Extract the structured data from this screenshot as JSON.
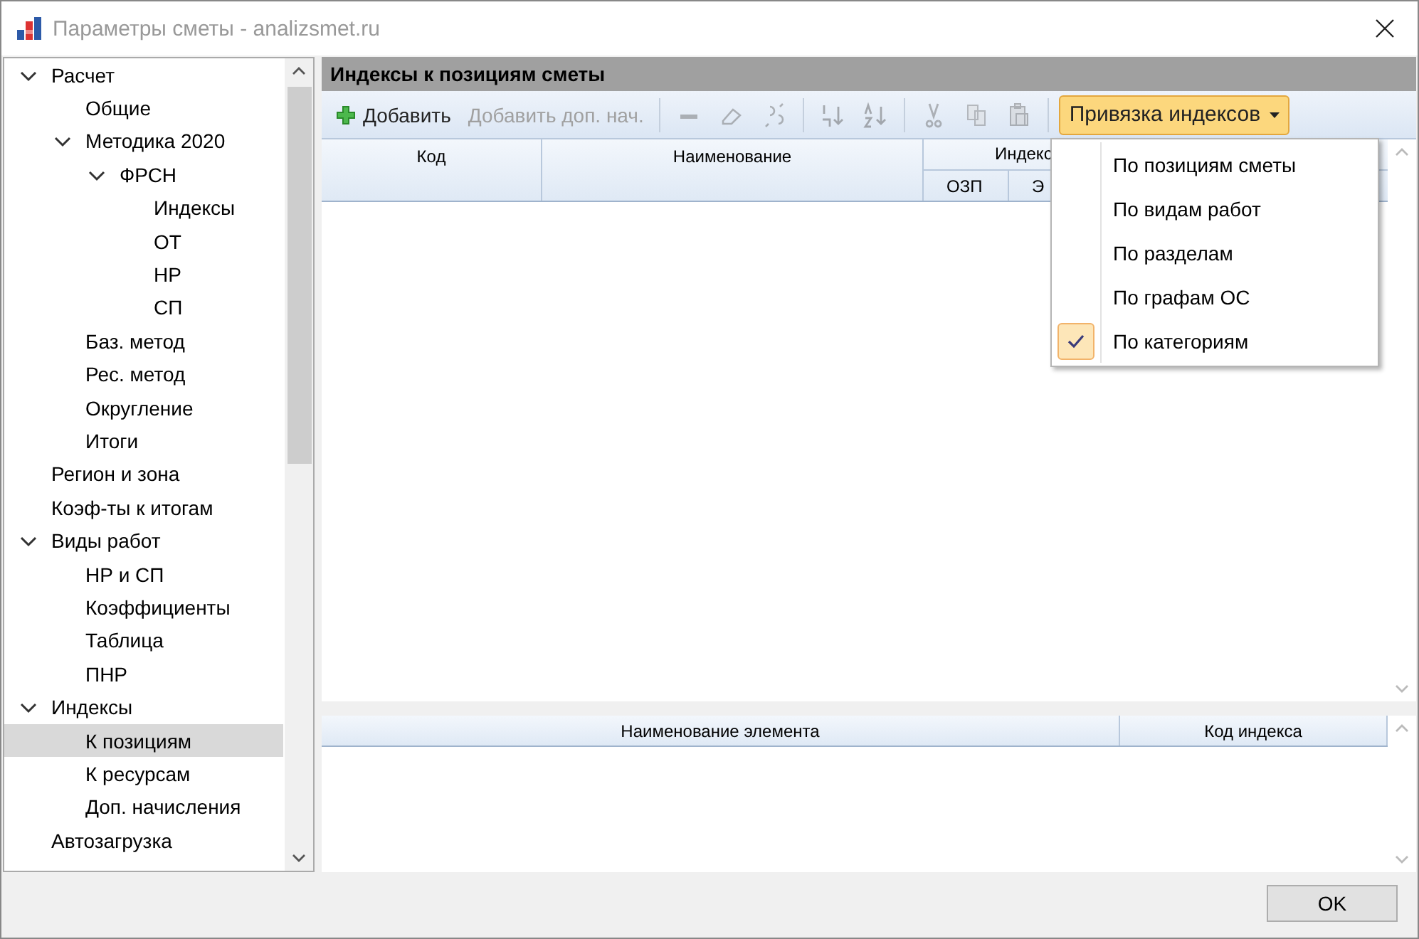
{
  "window": {
    "title": "Параметры сметы - analizsmet.ru"
  },
  "tree": [
    {
      "label": "Расчет",
      "expanded": true,
      "selected": false,
      "children": [
        {
          "label": "Общие",
          "selected": false
        },
        {
          "label": "Методика 2020",
          "expanded": true,
          "selected": false,
          "children": [
            {
              "label": "ФРСН",
              "expanded": true,
              "selected": false,
              "children": [
                {
                  "label": "Индексы",
                  "selected": false
                },
                {
                  "label": "ОТ",
                  "selected": false
                },
                {
                  "label": "НР",
                  "selected": false
                },
                {
                  "label": "СП",
                  "selected": false
                }
              ]
            }
          ]
        },
        {
          "label": "Баз. метод",
          "selected": false
        },
        {
          "label": "Рес. метод",
          "selected": false
        },
        {
          "label": "Округление",
          "selected": false
        },
        {
          "label": "Итоги",
          "selected": false
        }
      ]
    },
    {
      "label": "Регион и зона",
      "selected": false
    },
    {
      "label": "Коэф-ты к итогам",
      "selected": false
    },
    {
      "label": "Виды работ",
      "expanded": true,
      "selected": false,
      "children": [
        {
          "label": "НР и СП",
          "selected": false
        },
        {
          "label": "Коэффициенты",
          "selected": false
        },
        {
          "label": "Таблица",
          "selected": false
        },
        {
          "label": "ПНР",
          "selected": false
        }
      ]
    },
    {
      "label": "Индексы",
      "expanded": true,
      "selected": false,
      "children": [
        {
          "label": "К позициям",
          "selected": true
        },
        {
          "label": "К ресурсам",
          "selected": false
        },
        {
          "label": "Доп. начисления",
          "selected": false
        }
      ]
    },
    {
      "label": "Автозагрузка",
      "selected": false
    }
  ],
  "panel": {
    "title": "Индексы к позициям сметы"
  },
  "toolbar": {
    "items": [
      {
        "kind": "button",
        "label": "Добавить",
        "disabled": false
      },
      {
        "kind": "button",
        "label": "Добавить доп. нач.",
        "disabled": true
      },
      {
        "kind": "separator"
      },
      {
        "kind": "icon",
        "disabled": true
      },
      {
        "kind": "icon",
        "disabled": true
      },
      {
        "kind": "icon",
        "disabled": true
      },
      {
        "kind": "separator"
      },
      {
        "kind": "icon",
        "disabled": true
      },
      {
        "kind": "icon",
        "disabled": true
      },
      {
        "kind": "separator"
      },
      {
        "kind": "icon",
        "disabled": true
      },
      {
        "kind": "icon",
        "disabled": true
      },
      {
        "kind": "icon",
        "disabled": true
      },
      {
        "kind": "separator"
      }
    ],
    "dropdown": {
      "label": "Привязка индексов",
      "open": true
    }
  },
  "menu": [
    {
      "label": "По позициям сметы",
      "checked": false
    },
    {
      "label": "По видам работ",
      "checked": false
    },
    {
      "label": "По разделам",
      "checked": false
    },
    {
      "label": "По графам ОС",
      "checked": false
    },
    {
      "label": "По категориям",
      "checked": true
    }
  ],
  "grid": {
    "columns": [
      "Код",
      "Наименование"
    ],
    "group": {
      "label": "Индекс",
      "columns": [
        "ОЗП",
        "Э"
      ]
    }
  },
  "lower_grid": {
    "columns": [
      "Наименование элемента",
      "Код индекса"
    ]
  },
  "buttons": [
    "OK"
  ]
}
